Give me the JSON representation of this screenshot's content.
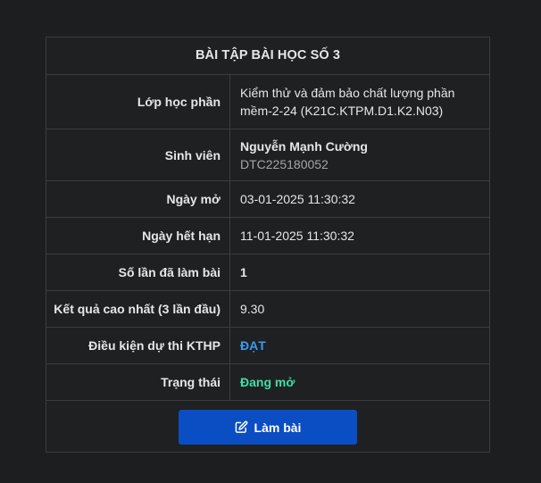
{
  "card": {
    "title": "BÀI TẬP BÀI HỌC SỐ 3"
  },
  "rows": {
    "class_label": "Lớp học phần",
    "class_value_line1": "Kiểm thử và đảm bảo chất lượng phần",
    "class_value_line2": "mềm-2-24 (K21C.KTPM.D1.K2.N03)",
    "student_label": "Sinh viên",
    "student_name": "Nguyễn Mạnh Cường",
    "student_id": "DTC225180052",
    "open_label": "Ngày mở",
    "open_value": "03-01-2025 11:30:32",
    "due_label": "Ngày hết hạn",
    "due_value": "11-01-2025 11:30:32",
    "attempts_label": "Số lần đã làm bài",
    "attempts_value": "1",
    "best_label": "Kết quả cao nhất (3 lần đầu)",
    "best_value": "9.30",
    "eligibility_label": "Điều kiện dự thi KTHP",
    "eligibility_value": "ĐẠT",
    "status_label": "Trạng thái",
    "status_value": "Đang mở"
  },
  "action": {
    "button_label": "Làm bài",
    "button_icon": "edit-icon"
  },
  "colors": {
    "background": "#1d1e20",
    "border": "#3a3c40",
    "button": "#0b4dc2",
    "pass": "#3a9bf0",
    "open": "#3ee0a4"
  }
}
